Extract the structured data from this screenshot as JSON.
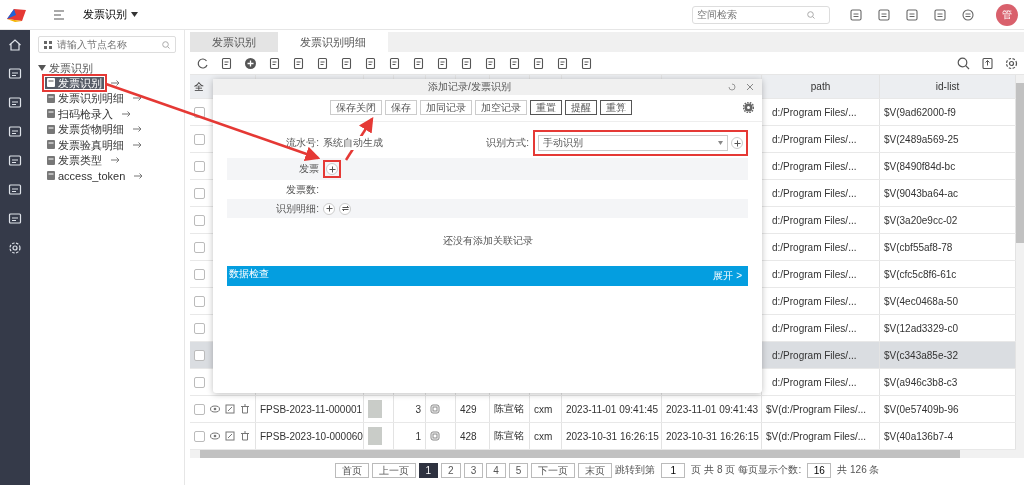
{
  "top_bar": {
    "module": "发票识别",
    "search": {
      "placeholder": "空间检索"
    },
    "avatar": "管"
  },
  "tree": {
    "search": {
      "placeholder": "请输入节点名称"
    },
    "root": {
      "label": "发票识别",
      "expanded": true,
      "children": [
        {
          "label": "发票识别",
          "selected": true
        },
        {
          "label": "发票识别明细",
          "selected": false
        },
        {
          "label": "扫码枪录入",
          "selected": false
        },
        {
          "label": "发票货物明细",
          "selected": false
        },
        {
          "label": "发票验真明细",
          "selected": false
        },
        {
          "label": "发票类型",
          "selected": false
        },
        {
          "label": "access_token",
          "selected": false
        }
      ]
    }
  },
  "tabs": [
    {
      "label": "发票识别",
      "selected": false
    },
    {
      "label": "发票识别明细",
      "selected": true
    }
  ],
  "table": {
    "header": {
      "column_1": "全",
      "path": "path",
      "id_list": "id-list"
    },
    "rows": [
      {
        "kind": "covered",
        "selected": false,
        "path": "d:/Program Files/...",
        "id_list": "$V(9ad62000-f9"
      },
      {
        "kind": "covered",
        "selected": false,
        "path": "d:/Program Files/...",
        "id_list": "$V(2489a569-25"
      },
      {
        "kind": "covered",
        "selected": false,
        "path": "d:/Program Files/...",
        "id_list": "$V(8490f84d-bc"
      },
      {
        "kind": "covered",
        "selected": false,
        "path": "d:/Program Files/...",
        "id_list": "$V(9043ba64-ac"
      },
      {
        "kind": "covered",
        "selected": false,
        "path": "d:/Program Files/...",
        "id_list": "$V(3a20e9cc-02"
      },
      {
        "kind": "covered",
        "selected": false,
        "path": "d:/Program Files/...",
        "id_list": "$V(cbf55af8-78"
      },
      {
        "kind": "covered",
        "selected": false,
        "path": "d:/Program Files/...",
        "id_list": "$V(cfc5c8f6-61c"
      },
      {
        "kind": "covered",
        "selected": false,
        "path": "d:/Program Files/...",
        "id_list": "$V(4ec0468a-50"
      },
      {
        "kind": "covered",
        "selected": false,
        "path": "d:/Program Files/...",
        "id_list": "$V(12ad3329-c0"
      },
      {
        "kind": "covered",
        "selected": true,
        "path": "d:/Program Files/...",
        "id_list": "$V(c343a85e-32"
      },
      {
        "kind": "covered",
        "selected": false,
        "path": "d:/Program Files/...",
        "id_list": "$V(a946c3b8-c3"
      },
      {
        "kind": "full",
        "selected": false,
        "code": "FPSB-2023-11-000001",
        "count": "3",
        "number": "429",
        "name": "陈宣铭",
        "user": "cxm",
        "created": "2023-11-01 09:41:45",
        "modified": "2023-11-01 09:41:43",
        "path": "$V(d:/Program Files/...",
        "id_list": "$V(0e57409b-96"
      },
      {
        "kind": "full",
        "selected": false,
        "code": "FPSB-2023-10-000060",
        "count": "1",
        "number": "428",
        "name": "陈宣铭",
        "user": "cxm",
        "created": "2023-10-31 16:26:15",
        "modified": "2023-10-31 16:26:15",
        "path": "$V(d:/Program Files/...",
        "id_list": "$V(40a136b7-4"
      }
    ]
  },
  "pagination": {
    "first": "首页",
    "prev": "上一页",
    "pages": [
      {
        "label": "1",
        "selected": true
      },
      {
        "label": "2",
        "selected": false
      },
      {
        "label": "3",
        "selected": false
      },
      {
        "label": "4",
        "selected": false
      },
      {
        "label": "5",
        "selected": false
      }
    ],
    "next": "下一页",
    "last": "末页",
    "jump_label": "跳转到第",
    "jump_value": "1",
    "page_unit": "页",
    "total_pages": "共 8 页",
    "per_page_label": "每页显示个数:",
    "per_page_value": "16",
    "total": "共 126 条"
  },
  "dialog": {
    "title": "添加记录/发票识别",
    "buttons": [
      {
        "label": "保存关闭",
        "kind": "plain"
      },
      {
        "label": "保存",
        "kind": "plain"
      },
      {
        "label": "加同记录",
        "kind": "plain"
      },
      {
        "label": "加空记录",
        "kind": "plain"
      },
      {
        "label": "重置",
        "kind": "strong"
      },
      {
        "label": "提醒",
        "kind": "strong"
      },
      {
        "label": "重算",
        "kind": "strong"
      }
    ],
    "serial": {
      "label": "流水号:",
      "value": "系统自动生成"
    },
    "method": {
      "label": "识别方式:",
      "value": "手动识别"
    },
    "invoice": {
      "label": "发票"
    },
    "invoice_count": {
      "label": "发票数:"
    },
    "details": {
      "label": "识别明细:"
    },
    "empty_message": "还没有添加关联记录",
    "panel": {
      "title": "数据检查",
      "toggle": "展开 >"
    }
  }
}
